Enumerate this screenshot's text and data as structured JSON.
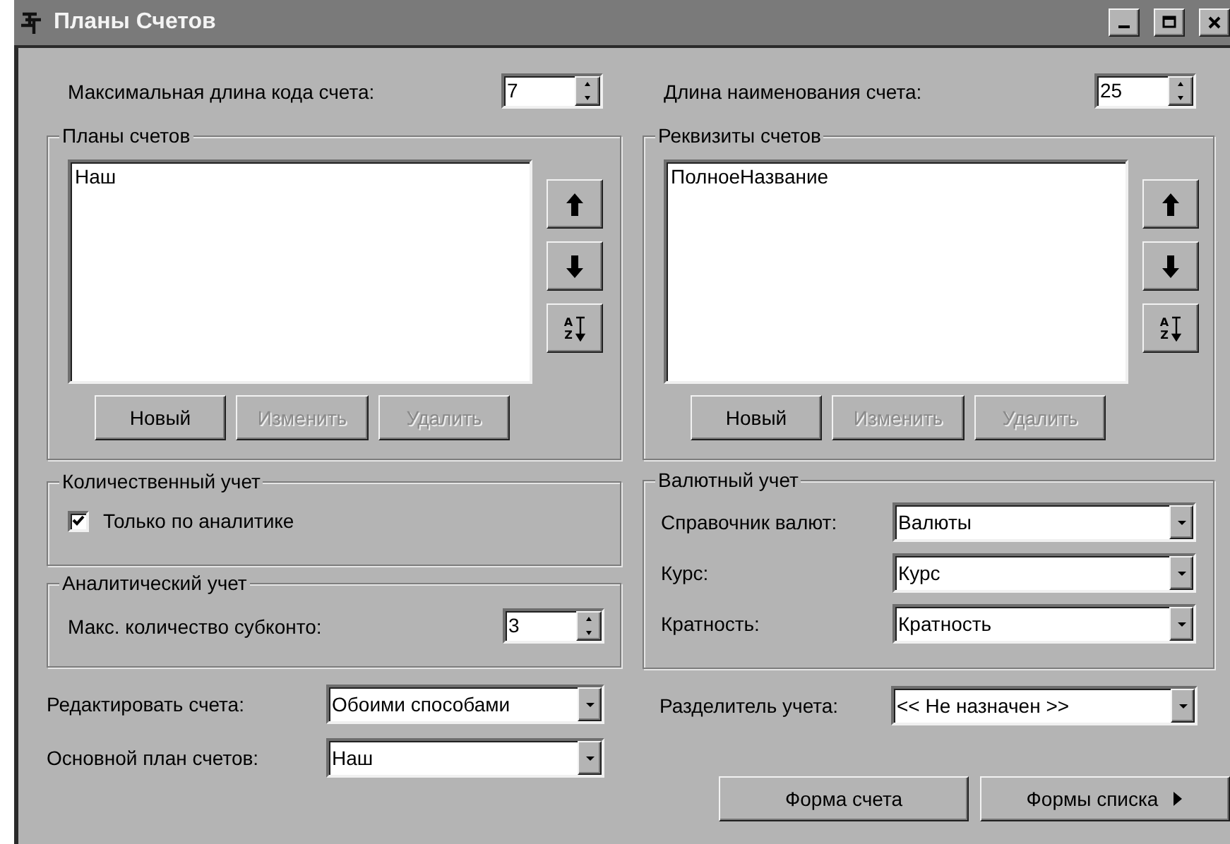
{
  "window": {
    "title": "Планы Счетов"
  },
  "left": {
    "max_code_length": {
      "label": "Максимальная длина кода счета:",
      "value": "7"
    },
    "plans": {
      "title": "Планы счетов",
      "items": [
        {
          "text": "Наш",
          "selected": false
        }
      ],
      "sort_letters": [
        "A",
        "Z"
      ],
      "buttons": [
        {
          "label": "Новый",
          "disabled": false
        },
        {
          "label": "Изменить",
          "disabled": true
        },
        {
          "label": "Удалить",
          "disabled": true
        }
      ]
    },
    "quantity": {
      "title": "Количественный учет",
      "checkbox": {
        "label": "Только по аналитике",
        "checked": true
      }
    },
    "analytic": {
      "title": "Аналитический учет",
      "field": {
        "label": "Макс. количество субконто:",
        "value": "3"
      }
    },
    "selects": [
      {
        "label": "Редактировать счета:",
        "value": "Обоими способами"
      },
      {
        "label": "Основной план счетов:",
        "value": "Наш"
      }
    ]
  },
  "right": {
    "name_length": {
      "label": "Длина наименования счета:",
      "value": "25"
    },
    "requisites": {
      "title": "Реквизиты счетов",
      "items": [
        {
          "text": "ПолноеНазвание",
          "selected": false
        }
      ],
      "sort_letters": [
        "A",
        "Z"
      ],
      "buttons": [
        {
          "label": "Новый",
          "disabled": false
        },
        {
          "label": "Изменить",
          "disabled": true
        },
        {
          "label": "Удалить",
          "disabled": true
        }
      ]
    },
    "currency": {
      "title": "Валютный учет",
      "fields": [
        {
          "label": "Справочник валют:",
          "value": "Валюты"
        },
        {
          "label": "Курс:",
          "value": "Курс"
        },
        {
          "label": "Кратность:",
          "value": "Кратность"
        }
      ]
    },
    "separator": {
      "label": "Разделитель учета:",
      "value": "<< Не назначен >>"
    },
    "buttons": [
      {
        "label": "Форма счета",
        "kind": "plain"
      },
      {
        "label": "Формы списка",
        "kind": "menu"
      }
    ]
  }
}
